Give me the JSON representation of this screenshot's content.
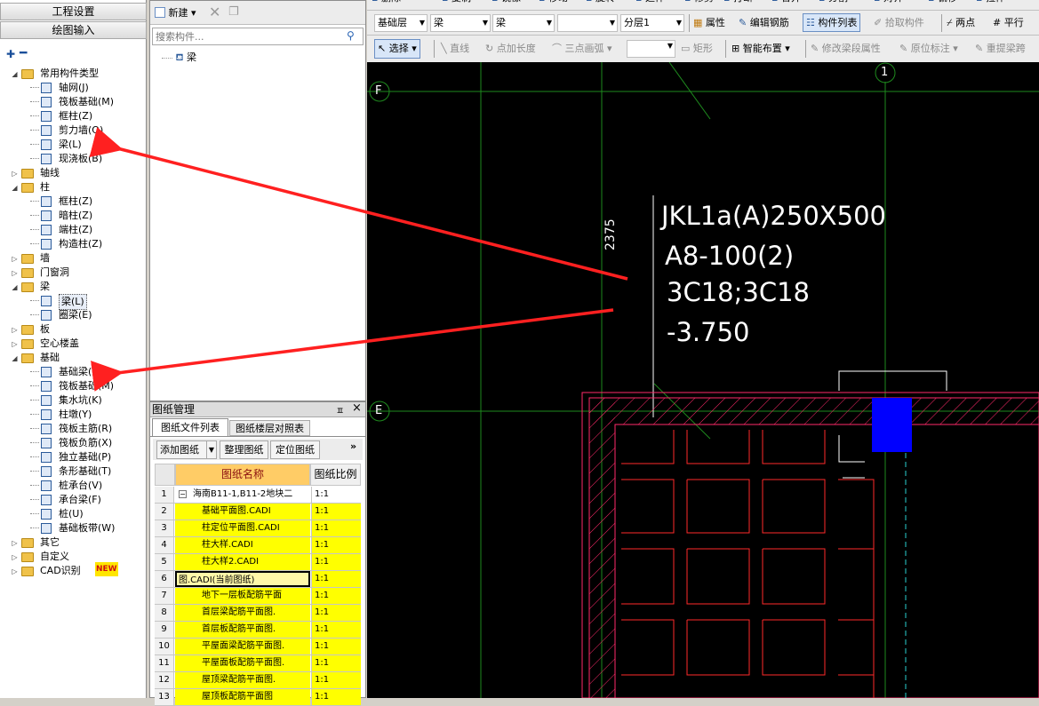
{
  "left_panel": {
    "btn1": "工程设置",
    "btn2": "绘图输入"
  },
  "tree": [
    {
      "label": "常用构件类型",
      "icon": "folder-icon",
      "type": "folder",
      "expander": "minus"
    },
    {
      "label": "轴网(J)",
      "icon": "axis-grid-icon",
      "type": "item"
    },
    {
      "label": "筏板基础(M)",
      "icon": "raft-foundation-icon",
      "type": "item"
    },
    {
      "label": "框柱(Z)",
      "icon": "column-icon",
      "type": "item"
    },
    {
      "label": "剪力墙(Q)",
      "icon": "shear-wall-icon",
      "type": "item"
    },
    {
      "label": "梁(L)",
      "icon": "beam-icon",
      "type": "item"
    },
    {
      "label": "现浇板(B)",
      "icon": "slab-icon",
      "type": "item"
    },
    {
      "label": "轴线",
      "icon": "folder-icon",
      "type": "folder",
      "expander": "plus"
    },
    {
      "label": "柱",
      "icon": "folder-icon",
      "type": "folder",
      "expander": "minus"
    },
    {
      "label": "框柱(Z)",
      "icon": "column-icon",
      "type": "item"
    },
    {
      "label": "暗柱(Z)",
      "icon": "column-icon",
      "type": "item"
    },
    {
      "label": "端柱(Z)",
      "icon": "column-icon",
      "type": "item"
    },
    {
      "label": "构造柱(Z)",
      "icon": "constructional-column-icon",
      "type": "item"
    },
    {
      "label": "墙",
      "icon": "folder-icon",
      "type": "folder",
      "expander": "plus"
    },
    {
      "label": "门窗洞",
      "icon": "folder-icon",
      "type": "folder",
      "expander": "plus"
    },
    {
      "label": "梁",
      "icon": "folder-icon",
      "type": "folder",
      "expander": "minus"
    },
    {
      "label": "梁(L)",
      "icon": "beam-icon",
      "type": "item",
      "selected": true
    },
    {
      "label": "圈梁(E)",
      "icon": "ring-beam-icon",
      "type": "item"
    },
    {
      "label": "板",
      "icon": "folder-icon",
      "type": "folder",
      "expander": "plus"
    },
    {
      "label": "空心楼盖",
      "icon": "folder-icon",
      "type": "folder",
      "expander": "plus"
    },
    {
      "label": "基础",
      "icon": "folder-icon",
      "type": "folder",
      "expander": "minus"
    },
    {
      "label": "基础梁(F)",
      "icon": "foundation-beam-icon",
      "type": "item"
    },
    {
      "label": "筏板基础(M)",
      "icon": "raft-foundation-icon",
      "type": "item"
    },
    {
      "label": "集水坑(K)",
      "icon": "sump-pit-icon",
      "type": "item"
    },
    {
      "label": "柱墩(Y)",
      "icon": "column-pier-icon",
      "type": "item"
    },
    {
      "label": "筏板主筋(R)",
      "icon": "raft-main-rebar-icon",
      "type": "item"
    },
    {
      "label": "筏板负筋(X)",
      "icon": "raft-negative-rebar-icon",
      "type": "item"
    },
    {
      "label": "独立基础(P)",
      "icon": "isolated-footing-icon",
      "type": "item"
    },
    {
      "label": "条形基础(T)",
      "icon": "strip-footing-icon",
      "type": "item"
    },
    {
      "label": "桩承台(V)",
      "icon": "pile-cap-icon",
      "type": "item"
    },
    {
      "label": "承台梁(F)",
      "icon": "cap-beam-icon",
      "type": "item"
    },
    {
      "label": "桩(U)",
      "icon": "pile-icon",
      "type": "item"
    },
    {
      "label": "基础板带(W)",
      "icon": "foundation-strip-icon",
      "type": "item"
    },
    {
      "label": "其它",
      "icon": "folder-icon",
      "type": "folder",
      "expander": "plus"
    },
    {
      "label": "自定义",
      "icon": "folder-icon",
      "type": "folder",
      "expander": "plus"
    },
    {
      "label": "CAD识别",
      "icon": "folder-icon",
      "type": "folder",
      "expander": "plus",
      "badge": "NEW"
    }
  ],
  "component_panel": {
    "new_label": "新建",
    "search_placeholder": "搜索构件...",
    "item": "梁"
  },
  "drawing_panel": {
    "title": "图纸管理",
    "pin": "ㅍ",
    "close": "×",
    "tabs": [
      "图纸文件列表",
      "图纸楼层对照表"
    ],
    "buttons": [
      "添加图纸",
      "整理图纸",
      "定位图纸"
    ],
    "more": "»",
    "headers": [
      "图纸名称",
      "图纸比例"
    ],
    "rows": [
      {
        "num": "1",
        "name": "海南B11-1,B11-2地块二",
        "scale": "1:1",
        "root": true
      },
      {
        "num": "2",
        "name": "基础平面图.CADI",
        "scale": "1:1"
      },
      {
        "num": "3",
        "name": "柱定位平面图.CADI",
        "scale": "1:1"
      },
      {
        "num": "4",
        "name": "柱大样.CADI",
        "scale": "1:1"
      },
      {
        "num": "5",
        "name": "柱大样2.CADI",
        "scale": "1:1"
      },
      {
        "num": "6",
        "name": "图.CADI(当前图纸)",
        "scale": "1:1",
        "current": true
      },
      {
        "num": "7",
        "name": "地下一层板配筋平面",
        "scale": "1:1"
      },
      {
        "num": "8",
        "name": "首层梁配筋平面图.",
        "scale": "1:1"
      },
      {
        "num": "9",
        "name": "首层板配筋平面图.",
        "scale": "1:1"
      },
      {
        "num": "10",
        "name": "平屋面梁配筋平面图.",
        "scale": "1:1"
      },
      {
        "num": "11",
        "name": "平屋面板配筋平面图.",
        "scale": "1:1"
      },
      {
        "num": "12",
        "name": "屋顶梁配筋平面图.",
        "scale": "1:1"
      },
      {
        "num": "13",
        "name": "屋顶板配筋平面图",
        "scale": "1:1"
      }
    ]
  },
  "toolbar_top": [
    "删除",
    "复制",
    "镜像",
    "移动",
    "旋转",
    "延伸",
    "修剪",
    "打断",
    "合并",
    "分割",
    "对齐",
    "偏移",
    "拉伸"
  ],
  "toolbar_row2": {
    "floor": "基础层",
    "type": "梁",
    "comp": "梁",
    "extra": "",
    "layer": "分层1",
    "buttons": [
      "属性",
      "编辑钢筋",
      "构件列表",
      "拾取构件",
      "两点",
      "平行"
    ]
  },
  "toolbar_row3": [
    "选择",
    "直线",
    "点加长度",
    "三点画弧",
    "矩形",
    "智能布置",
    "修改梁段属性",
    "原位标注",
    "重提梁跨"
  ],
  "cad": {
    "axis_1": "1",
    "axis_F": "F",
    "axis_E": "E",
    "dim": "2375",
    "annotation": [
      "JKL1a(A)250X500",
      "A8-100(2)",
      "3C18;3C18",
      "-3.750"
    ]
  }
}
